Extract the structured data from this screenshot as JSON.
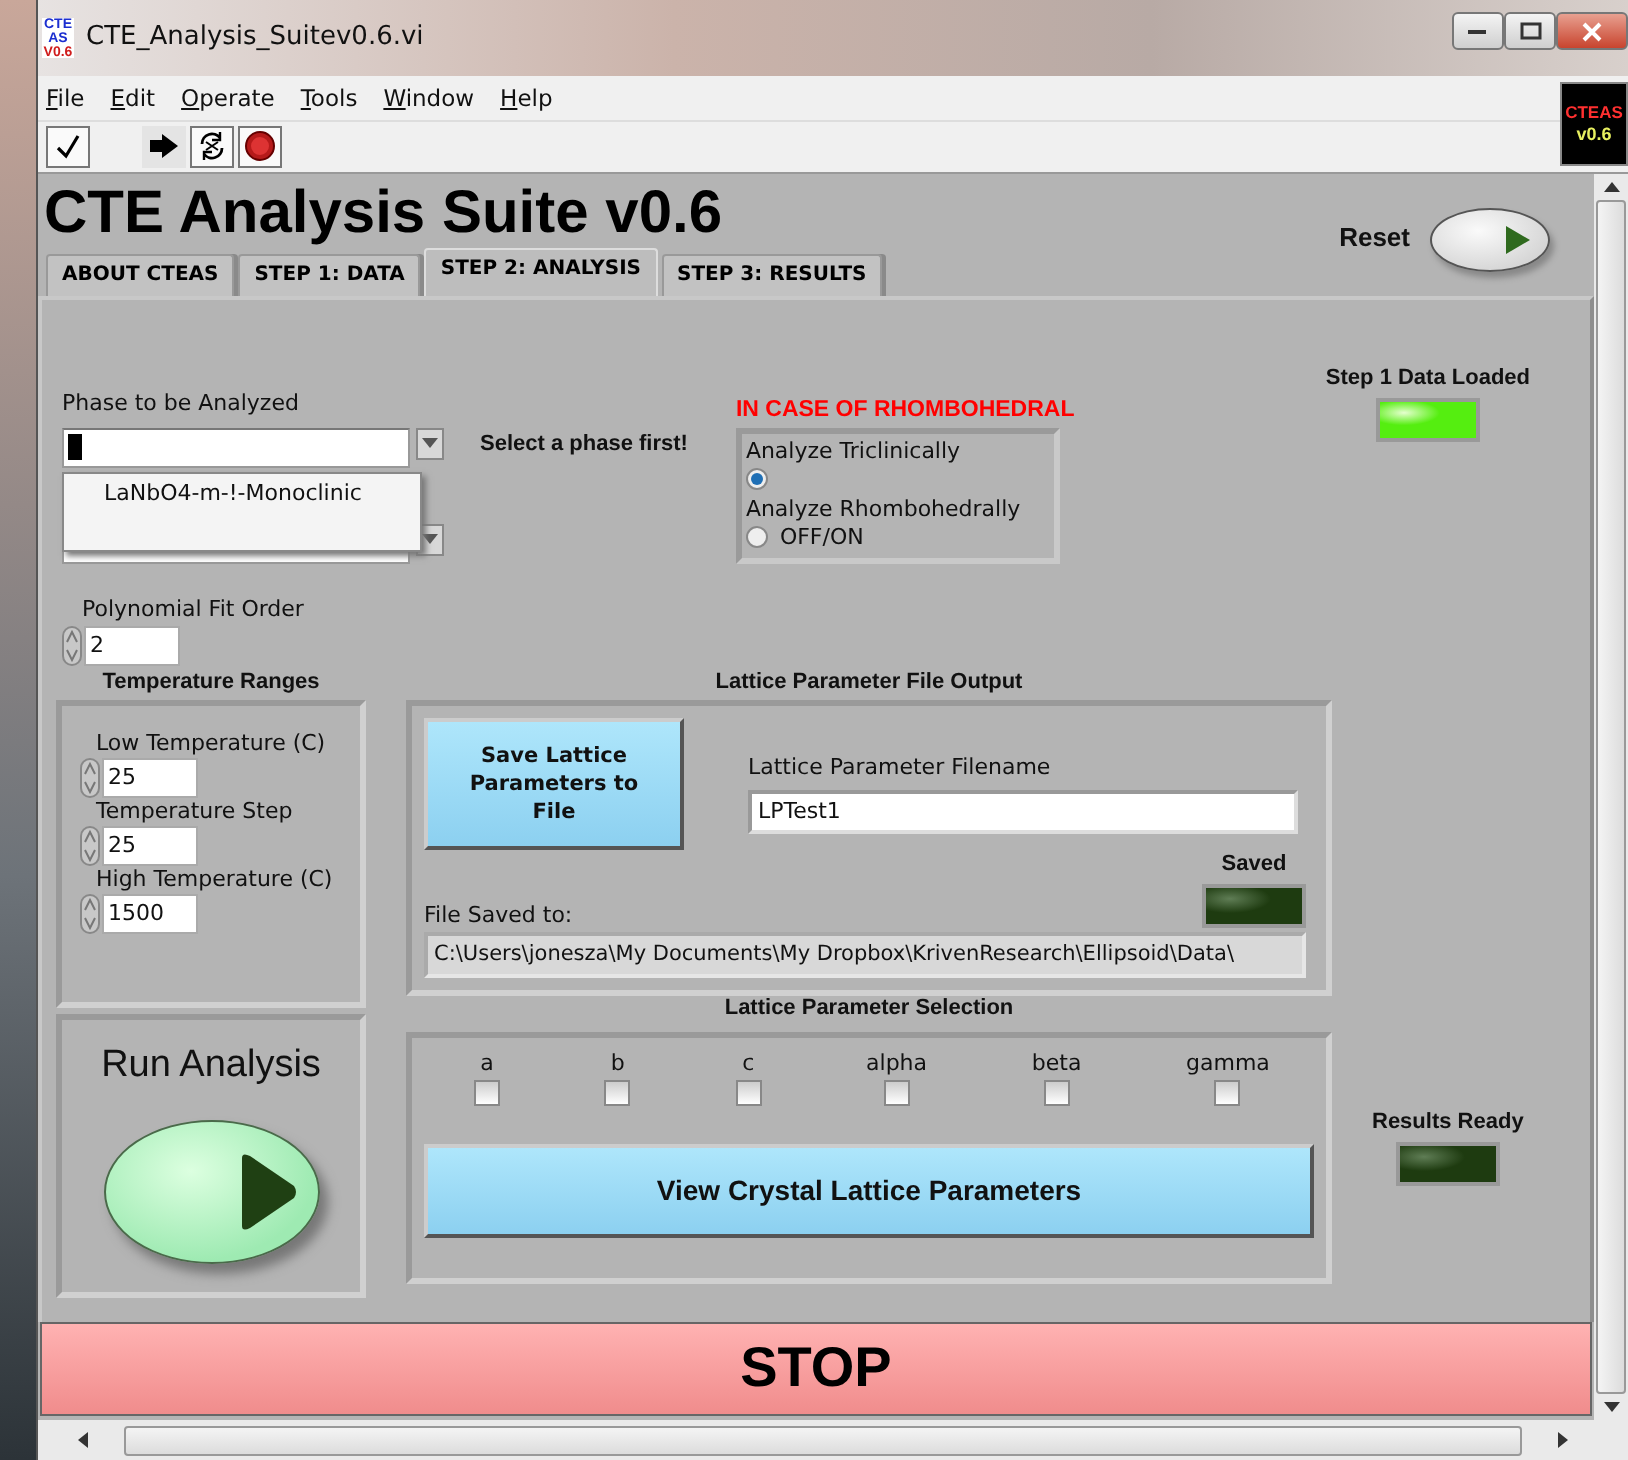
{
  "window": {
    "title": "CTE_Analysis_Suitev0.6.vi",
    "icon_text": [
      "CTE",
      "AS",
      "V0.6"
    ]
  },
  "menu": [
    {
      "label": "File"
    },
    {
      "label": "Edit"
    },
    {
      "label": "Operate"
    },
    {
      "label": "Tools"
    },
    {
      "label": "Window"
    },
    {
      "label": "Help"
    }
  ],
  "toolbar": {
    "logo": [
      "CTEAS",
      "v0.6"
    ]
  },
  "panel": {
    "title": "CTE Analysis Suite v0.6",
    "reset_label": "Reset"
  },
  "tabs": [
    {
      "label": "ABOUT CTEAS",
      "selected": false
    },
    {
      "label": "STEP 1: DATA",
      "selected": false
    },
    {
      "label": "STEP 2: ANALYSIS",
      "selected": true
    },
    {
      "label": "STEP 3: RESULTS",
      "selected": false
    }
  ],
  "phase": {
    "label": "Phase to be Analyzed",
    "hint": "Select a phase first!",
    "dropdown_open": true,
    "options": [
      "LaNbO4-m-!-Monoclinic"
    ]
  },
  "rhombohedral": {
    "heading": "IN CASE OF RHOMBOHEDRAL",
    "options": [
      {
        "label": "Analyze Triclinically",
        "selected": true
      },
      {
        "label": "Analyze Rhombohedrally",
        "selected": false,
        "caption": "OFF/ON"
      }
    ]
  },
  "step1_led": {
    "label": "Step 1 Data Loaded",
    "on": true
  },
  "polynomial": {
    "label": "Polynomial Fit Order",
    "value": "2"
  },
  "temperature_ranges": {
    "title": "Temperature Ranges",
    "fields": [
      {
        "label": "Low Temperature (C)",
        "value": "25"
      },
      {
        "label": "Temperature Step",
        "value": "25"
      },
      {
        "label": "High Temperature (C)",
        "value": "1500"
      }
    ]
  },
  "run_analysis": {
    "label": "Run Analysis"
  },
  "file_output": {
    "title": "Lattice Parameter File Output",
    "save_button": "Save Lattice Parameters to File",
    "filename_label": "Lattice Parameter Filename",
    "filename": "LPTest1",
    "saved": {
      "label": "Saved",
      "on": false
    },
    "path_label": "File Saved to:",
    "path": "C:\\Users\\jonesza\\My Documents\\My Dropbox\\KrivenResearch\\Ellipsoid\\Data\\"
  },
  "selection": {
    "title": "Lattice Parameter Selection",
    "params": [
      {
        "label": "a",
        "checked": false
      },
      {
        "label": "b",
        "checked": false
      },
      {
        "label": "c",
        "checked": false
      },
      {
        "label": "alpha",
        "checked": false
      },
      {
        "label": "beta",
        "checked": false
      },
      {
        "label": "gamma",
        "checked": false
      }
    ],
    "view_button": "View Crystal Lattice Parameters"
  },
  "results_ready": {
    "label": "Results Ready",
    "on": false
  },
  "stop": {
    "label": "STOP"
  }
}
